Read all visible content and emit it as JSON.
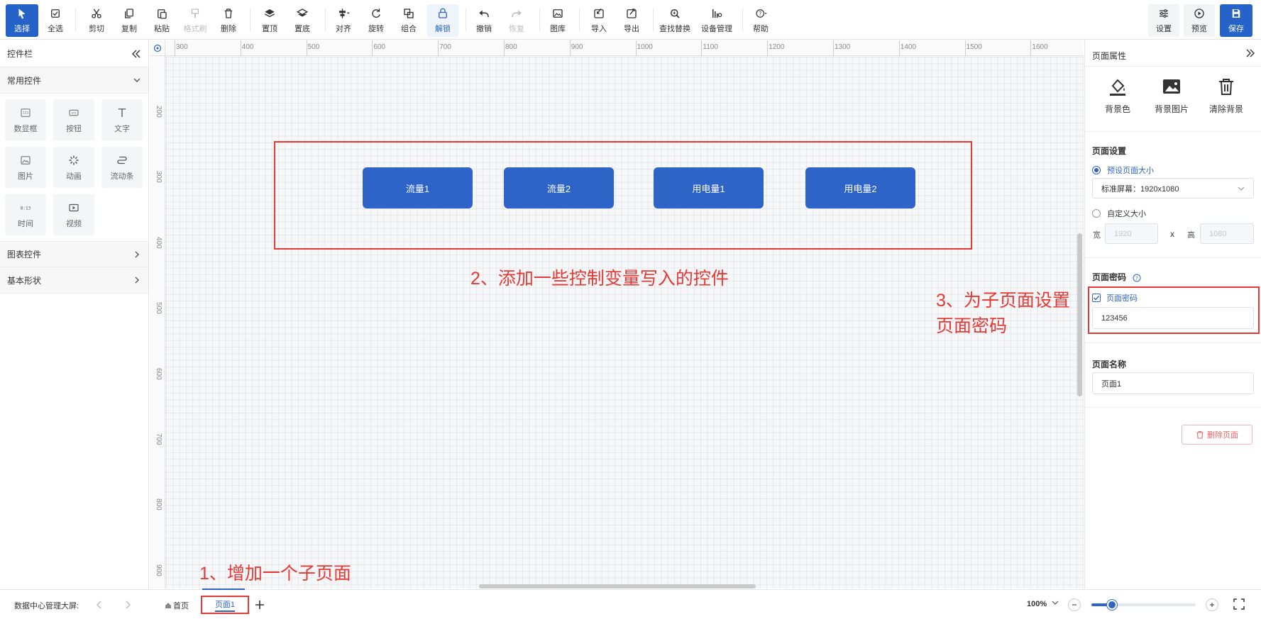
{
  "toolbar": {
    "select": "选择",
    "select_all": "全选",
    "cut": "剪切",
    "copy": "复制",
    "paste": "粘贴",
    "format_brush": "格式刷",
    "delete": "删除",
    "bring_top": "置顶",
    "send_bottom": "置底",
    "align": "对齐",
    "rotate": "旋转",
    "group": "组合",
    "unlock": "解锁",
    "undo": "撤销",
    "redo": "恢复",
    "gallery": "图库",
    "import": "导入",
    "export": "导出",
    "find_replace": "查找替换",
    "device_mgmt": "设备管理",
    "help": "帮助",
    "settings": "设置",
    "preview": "预览",
    "save": "保存"
  },
  "left_panel": {
    "title": "控件栏",
    "common_section": "常用控件",
    "common_items": [
      "数显框",
      "按钮",
      "文字",
      "图片",
      "动画",
      "流动条",
      "时间",
      "视频"
    ],
    "chart_section": "图表控件",
    "shape_section": "基本形状"
  },
  "rulers": {
    "top": [
      "300",
      "400",
      "500",
      "600",
      "700",
      "800",
      "900",
      "1000",
      "1100",
      "1200",
      "1300",
      "1400",
      "1500",
      "1600"
    ],
    "left": [
      "200",
      "300",
      "400",
      "500",
      "600",
      "700",
      "800",
      "900"
    ]
  },
  "canvas": {
    "buttons": [
      "流量1",
      "流量2",
      "用电量1",
      "用电量2"
    ],
    "annotation_2": "2、添加一些控制变量写入的控件",
    "annotation_3_line1": "3、为子页面设置",
    "annotation_3_line2": "页面密码",
    "annotation_1": "1、增加一个子页面"
  },
  "right_panel": {
    "title": "页面属性",
    "bg_color": "背景色",
    "bg_image": "背景图片",
    "clear_bg": "清除背景",
    "page_settings": "页面设置",
    "preset_size": "预设页面大小",
    "preset_value": "标准屏幕：1920x1080",
    "custom_size": "自定义大小",
    "width_label": "宽",
    "width_value": "1920",
    "x_sep": "x",
    "height_label": "高",
    "height_value": "1080",
    "password_section": "页面密码",
    "password_checkbox": "页面密码",
    "password_value": "123456",
    "name_section": "页面名称",
    "name_value": "页面1",
    "delete_page": "删除页面"
  },
  "bottom_bar": {
    "project_name": "数据中心管理大屏:",
    "tabs": [
      "首页",
      "页面1"
    ],
    "zoom": "100%",
    "zoom_level": 0.2
  },
  "colors": {
    "accent": "#2e63c7",
    "annotation": "#e53935"
  }
}
